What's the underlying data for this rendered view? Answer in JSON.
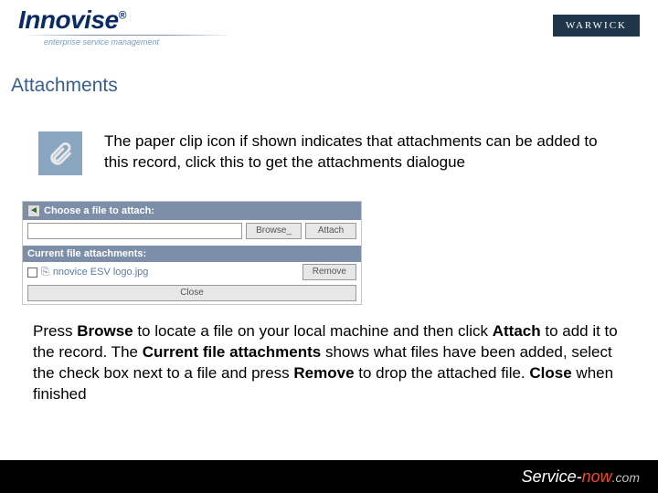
{
  "header": {
    "logo_text": "Innovise",
    "logo_reg": "®",
    "logo_tagline": "enterprise service management",
    "warwick_label": "WARWICK"
  },
  "section_title": "Attachments",
  "intro_text": "The paper clip icon if shown indicates that attachments can be added to this record, click this to get the attachments dialogue",
  "dialog": {
    "choose_label": "Choose a file to attach:",
    "browse_btn": "Browse_",
    "attach_btn": "Attach",
    "current_label": "Current file attachments:",
    "file_name": "nnovice ESV logo.jpg",
    "remove_btn": "Remove",
    "close_btn": "Close"
  },
  "instructions": {
    "p1a": "Press ",
    "b1": "Browse",
    "p1b": " to locate a file on your local machine and then click ",
    "b2": "Attach",
    "p1c": " to add it to the record. The ",
    "b3": "Current file attachments",
    "p1d": " shows what files have been added, select the check box next to a file and press ",
    "b4": "Remove",
    "p1e": " to drop the attached file. ",
    "b5": "Close",
    "p1f": " when finished"
  },
  "footer": {
    "service": "Service",
    "dash": "-",
    "now": "now",
    "dotcom": ".com"
  }
}
